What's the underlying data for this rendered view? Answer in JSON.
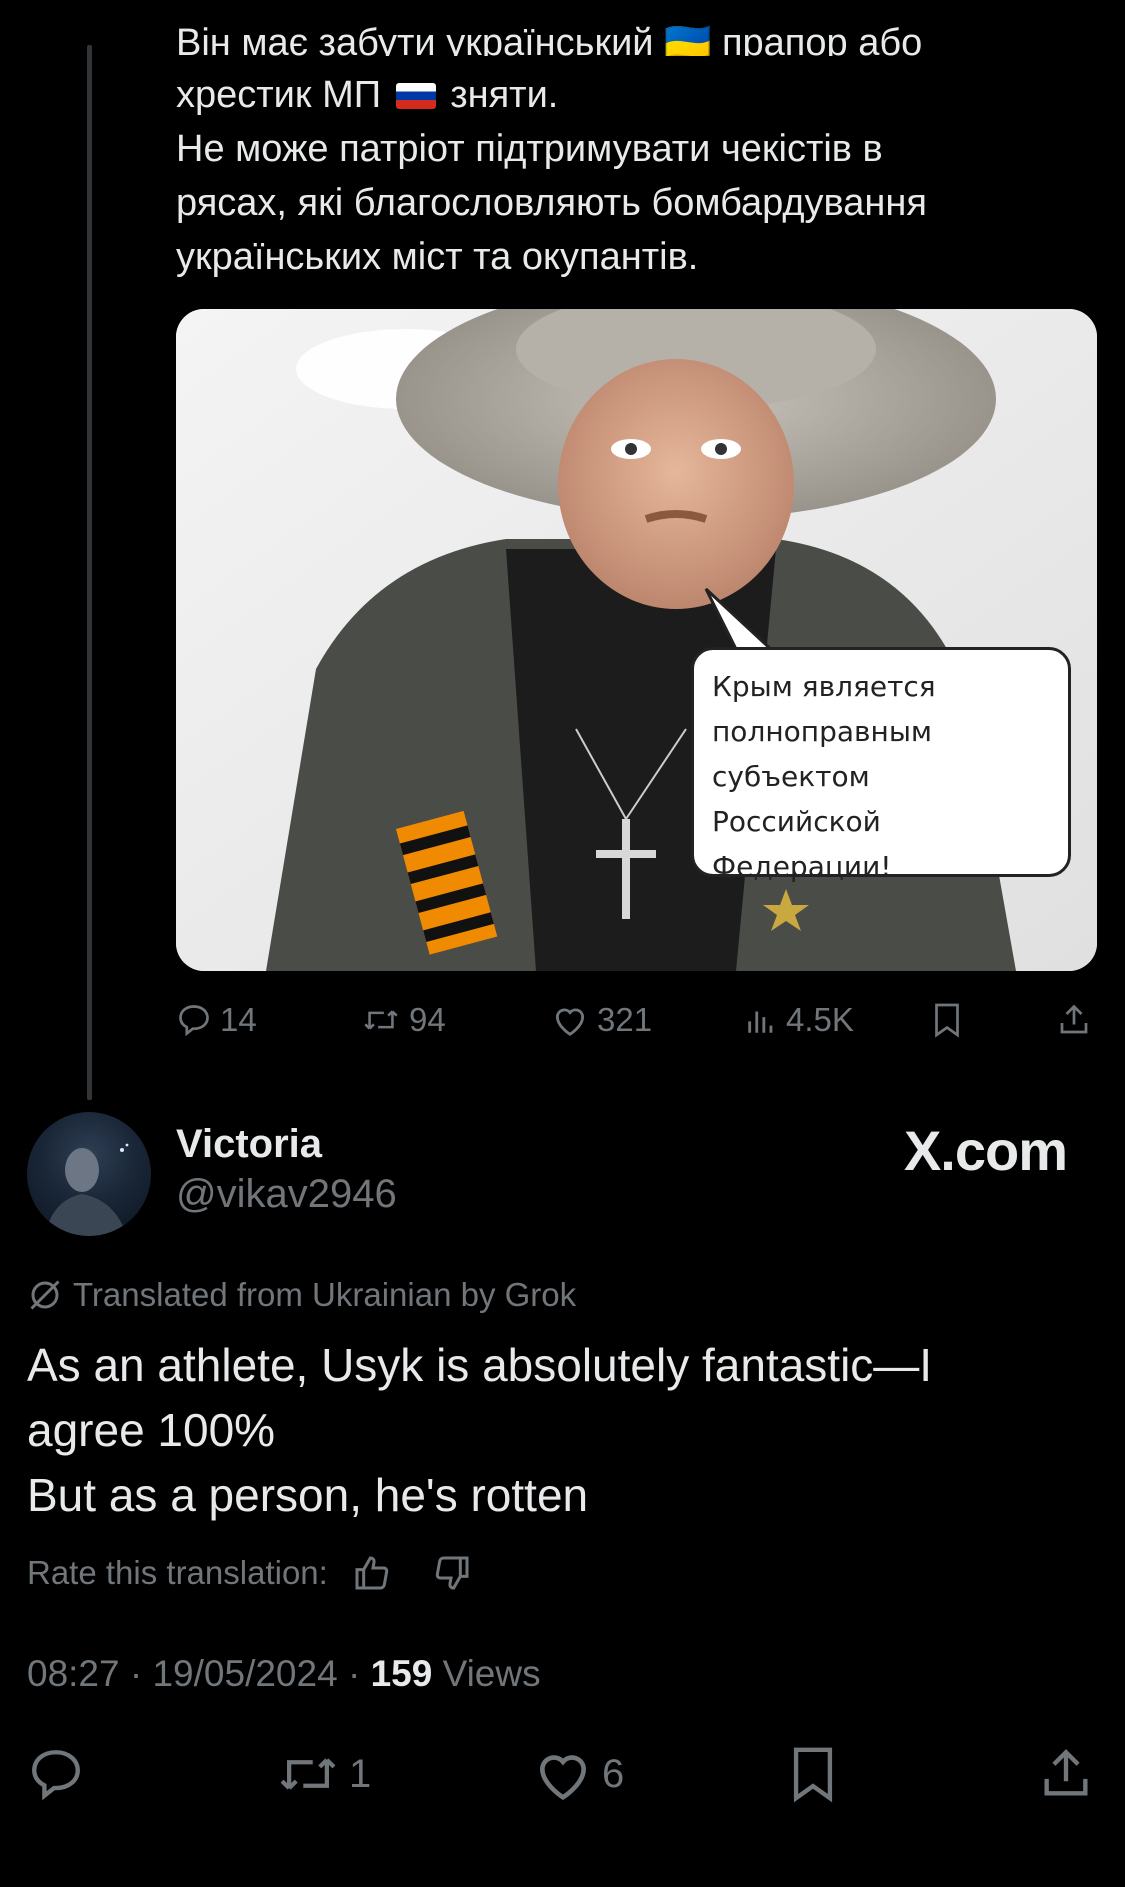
{
  "parent_tweet": {
    "text_cut_line": "Він має забути український 🇺🇦 прапор або",
    "text_line2_before_flag": "хрестик МП",
    "text_line2_after_flag": "зняти.",
    "text_line3": "Не може патріот підтримувати чекістів в",
    "text_line4": "рясах, які благословляють бомбардування",
    "text_line5": "українських міст та окупантів.",
    "image_bubble_lines": [
      "Крым является",
      "полноправным",
      "субъектом",
      "Российской",
      "Федерации!"
    ],
    "actions": {
      "replies": "14",
      "reposts": "94",
      "likes": "321",
      "views": "4.5K"
    }
  },
  "reply_tweet": {
    "display_name": "Victoria",
    "handle": "@vikav2946",
    "watermark": "X.com",
    "translated_label": "Translated from Ukrainian by Grok",
    "body_lines": [
      "As an athlete, Usyk is absolutely fantastic—I",
      "agree 100%",
      "But as a person, he's rotten"
    ],
    "rate_label": "Rate this translation:",
    "time": "08:27",
    "date": "19/05/2024",
    "views_count": "159",
    "views_label": "Views",
    "actions": {
      "reposts": "1",
      "likes": "6"
    }
  },
  "colors": {
    "background": "#000000",
    "text_primary": "#e7e9ea",
    "text_secondary": "#71767b"
  }
}
